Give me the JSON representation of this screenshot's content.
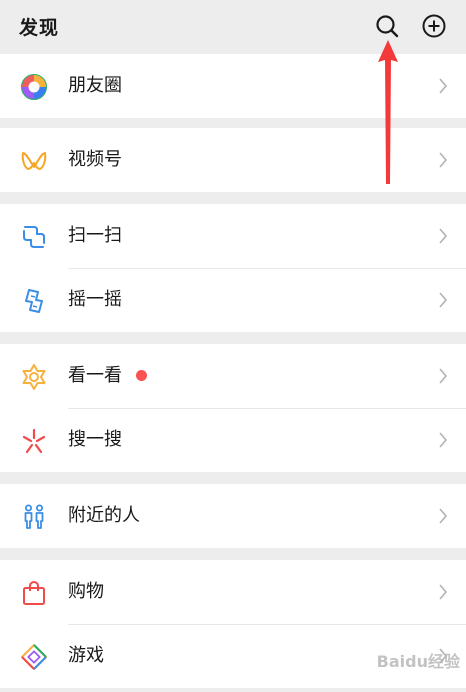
{
  "header": {
    "title": "发现"
  },
  "icons": {
    "search": "search-icon",
    "add": "plus-circle-icon"
  },
  "items": {
    "moments": {
      "label": "朋友圈",
      "icon": "moments-icon"
    },
    "channels": {
      "label": "视频号",
      "icon": "channels-icon"
    },
    "scan": {
      "label": "扫一扫",
      "icon": "scan-icon"
    },
    "shake": {
      "label": "摇一摇",
      "icon": "shake-icon"
    },
    "top_stories": {
      "label": "看一看",
      "icon": "top-stories-icon",
      "has_red_dot": true
    },
    "search": {
      "label": "搜一搜",
      "icon": "search-star-icon"
    },
    "nearby": {
      "label": "附近的人",
      "icon": "people-nearby-icon"
    },
    "shopping": {
      "label": "购物",
      "icon": "shopping-bag-icon"
    },
    "games": {
      "label": "游戏",
      "icon": "games-icon"
    }
  },
  "watermark": "Baidu经验",
  "colors": {
    "background": "#ededed",
    "red_dot": "#fa5151",
    "annotation_arrow": "#f23a3a"
  }
}
